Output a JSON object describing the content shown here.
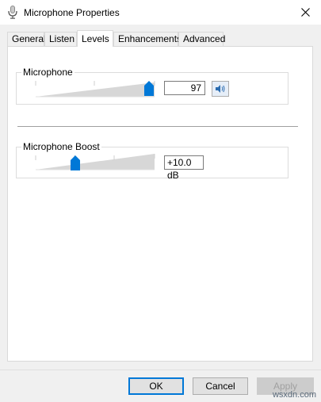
{
  "window": {
    "title": "Microphone Properties",
    "icon": "microphone-icon",
    "close_icon": "close-icon"
  },
  "tabs": [
    {
      "label": "General",
      "active": false
    },
    {
      "label": "Listen",
      "active": false
    },
    {
      "label": "Levels",
      "active": true
    },
    {
      "label": "Enhancements",
      "active": false
    },
    {
      "label": "Advanced",
      "active": false
    }
  ],
  "microphone": {
    "label": "Microphone",
    "value": "97",
    "level": 97,
    "speaker_icon": "speaker-icon"
  },
  "boost": {
    "label": "Microphone Boost",
    "value": "+10.0 dB",
    "level_fraction": 0.33
  },
  "buttons": {
    "ok": "OK",
    "cancel": "Cancel",
    "apply": "Apply"
  },
  "watermark": "wsxdn.com",
  "colors": {
    "accent": "#0078d7",
    "slider_fill": "#d7d7d7"
  }
}
